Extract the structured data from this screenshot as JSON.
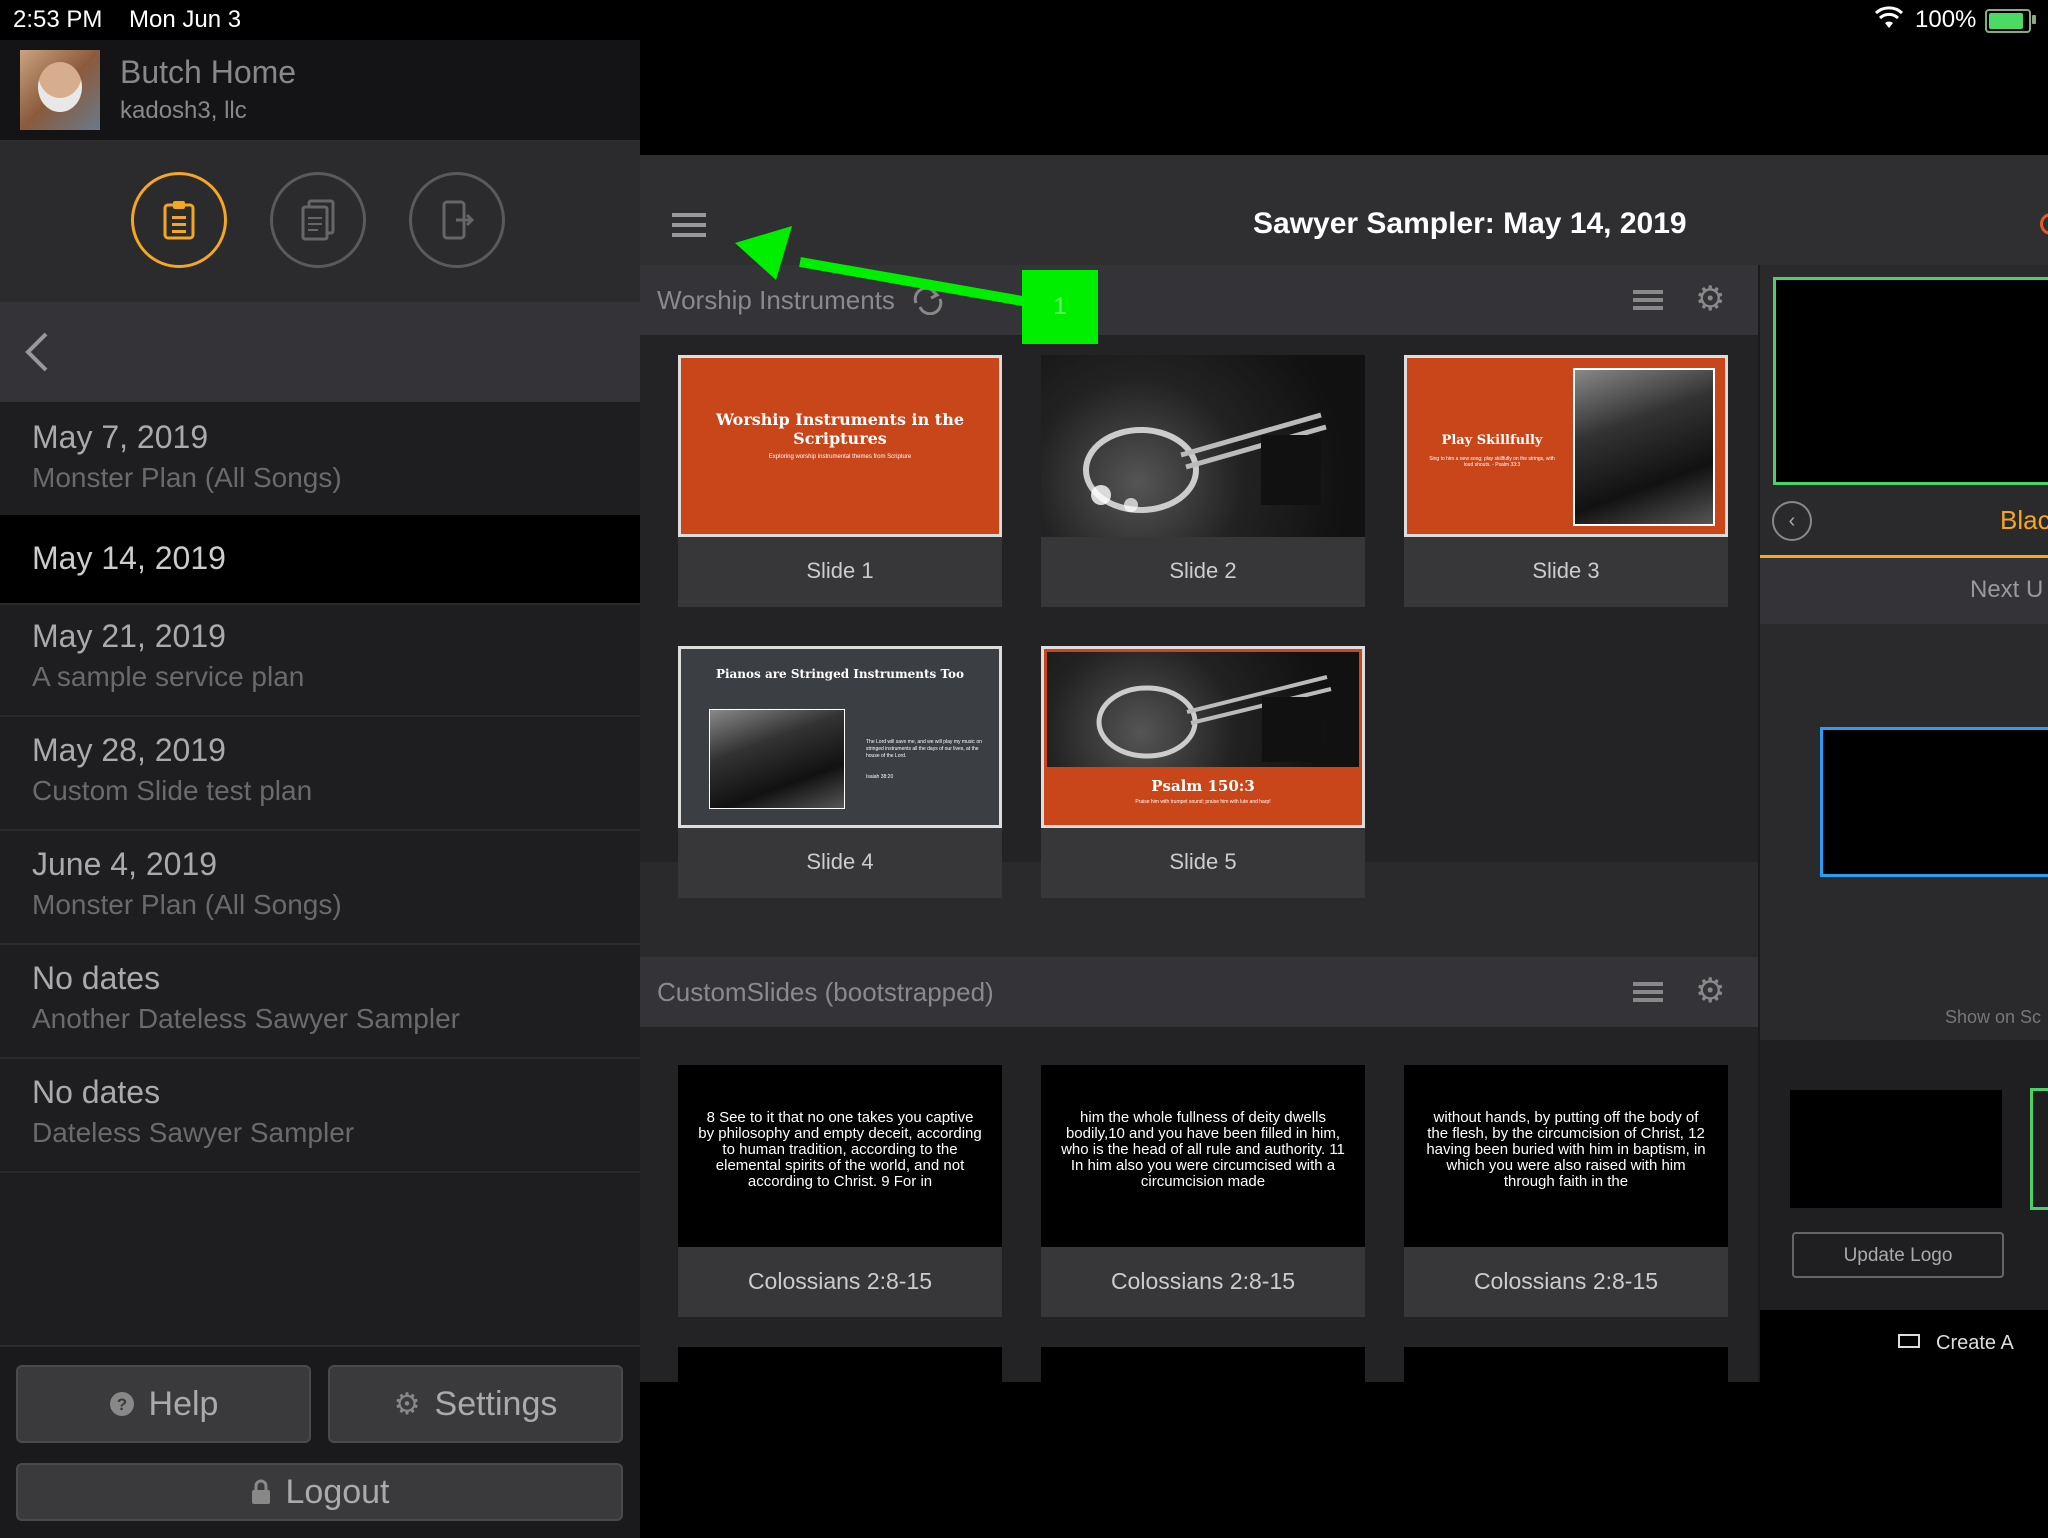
{
  "status_bar": {
    "time": "2:53 PM",
    "date": "Mon Jun 3",
    "battery": "100%"
  },
  "profile": {
    "name": "Butch Home",
    "company": "kadosh3, llc"
  },
  "plans": [
    {
      "date": "May 7, 2019",
      "title": "Monster Plan (All Songs)"
    },
    {
      "date": "May 14, 2019",
      "title": ""
    },
    {
      "date": "May 21, 2019",
      "title": "A sample service plan"
    },
    {
      "date": "May 28, 2019",
      "title": "Custom Slide test plan"
    },
    {
      "date": "June 4, 2019",
      "title": "Monster Plan (All Songs)"
    },
    {
      "date": "No dates",
      "title": "Another Dateless Sawyer Sampler"
    },
    {
      "date": "No dates",
      "title": "Dateless Sawyer Sampler"
    }
  ],
  "bottom_buttons": {
    "help": "Help",
    "settings": "Settings",
    "logout": "Logout"
  },
  "header": {
    "title": "Sawyer Sampler: May 14, 2019"
  },
  "sections": {
    "worship": {
      "title": "Worship Instruments",
      "slides": [
        {
          "label": "Slide 1",
          "heading": "Worship Instruments in the Scriptures",
          "sub": "Exploring worship instrumental themes from Scripture"
        },
        {
          "label": "Slide 2"
        },
        {
          "label": "Slide 3",
          "heading": "Play Skillfully",
          "sub": "Sing to him a new song; play skillfully on the strings, with loud shouts. - Psalm 33:3"
        },
        {
          "label": "Slide 4",
          "heading": "Pianos are Stringed Instruments Too",
          "sub": "The Lord will save me, and we will play my music on stringed instruments all the days of our lives, at the house of the Lord.",
          "ref": "Isaiah 38:20"
        },
        {
          "label": "Slide 5",
          "heading": "Psalm 150:3",
          "sub": "Praise him with trumpet sound; praise him with lute and harp!"
        }
      ]
    },
    "custom": {
      "title": "CustomSlides (bootstrapped)",
      "slides": [
        {
          "label": "Colossians 2:8-15",
          "text": "8 See to it that no one takes you captive by philosophy and empty deceit, according to human tradition, according to the elemental spirits of the world, and not according to Christ. 9 For in"
        },
        {
          "label": "Colossians 2:8-15",
          "text": "him the whole fullness of deity dwells bodily,10 and you have been filled in him, who is the head of all rule and authority. 11 In him also you were circumcised with a circumcision made"
        },
        {
          "label": "Colossians 2:8-15",
          "text": "without hands, by putting off the body of the flesh, by the circumcision of Christ, 12 having been buried with him in baptism, in which you were also raised with him through faith in the"
        }
      ]
    }
  },
  "right_panel": {
    "black": "Black",
    "next": "Next U",
    "show_on": "Show on Sc",
    "update_logo": "Update Logo",
    "create": "Create A"
  },
  "annotation": {
    "label": "1",
    "color": "#00ee00"
  },
  "colors": {
    "accent": "#f5a623",
    "live_border": "#4bd06a",
    "next_border": "#2a9df4",
    "slide_orange": "#c9461b"
  }
}
